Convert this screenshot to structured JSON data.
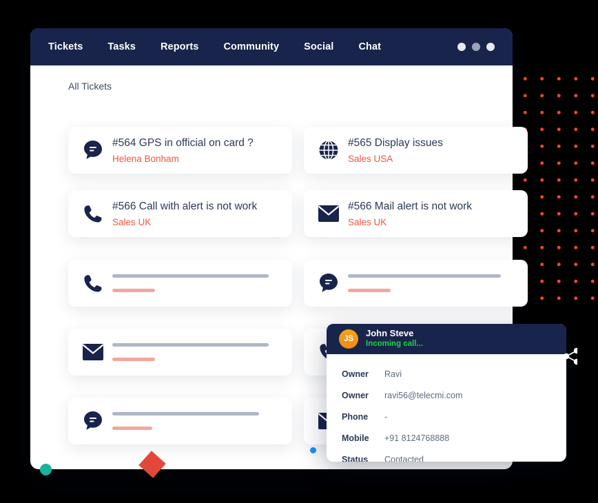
{
  "window": {
    "nav": [
      {
        "label": "Tickets"
      },
      {
        "label": "Tasks"
      },
      {
        "label": "Reports"
      },
      {
        "label": "Community"
      },
      {
        "label": "Social"
      },
      {
        "label": "Chat"
      }
    ],
    "window_controls": [
      "dot-light",
      "dot-gray",
      "dot-light"
    ]
  },
  "main": {
    "section_title": "All Tickets",
    "tickets": [
      {
        "icon": "chat-bubble-icon",
        "title": "#564 GPS in official on card ?",
        "subtitle": "Helena Bonham"
      },
      {
        "icon": "globe-icon",
        "title": "#565 Display issues",
        "subtitle": "Sales USA"
      },
      {
        "icon": "phone-icon",
        "title": "#566 Call with alert is not work",
        "subtitle": "Sales UK"
      },
      {
        "icon": "mail-icon",
        "title": "#566 Mail alert is not work",
        "subtitle": "Sales UK"
      }
    ],
    "placeholders": [
      {
        "icon": "phone-icon"
      },
      {
        "icon": "chat-bubble-icon"
      },
      {
        "icon": "mail-icon"
      },
      {
        "icon": "phone-icon"
      },
      {
        "icon": "chat-bubble-icon"
      },
      {
        "icon": "mail-icon"
      }
    ]
  },
  "call_popup": {
    "avatar_initials": "JS",
    "name": "John Steve",
    "status_text": "Incoming call...",
    "fields": [
      {
        "key": "Owner",
        "value": "Ravi"
      },
      {
        "key": "Owner",
        "value": "ravi56@telecmi.com"
      },
      {
        "key": "Phone",
        "value": "-"
      },
      {
        "key": "Mobile",
        "value": "+91 8124768888"
      },
      {
        "key": "Status",
        "value": "Contacted"
      }
    ]
  },
  "decorations": {
    "dot_grid_color": "#ef4631",
    "yellow_blob_color": "#ffc20e",
    "teal_dot_color": "#18b39a",
    "red_square_color": "#e2483a",
    "page_dot_color": "#1a8cff",
    "navy": "#18244c",
    "accent_red": "#f2543d"
  }
}
